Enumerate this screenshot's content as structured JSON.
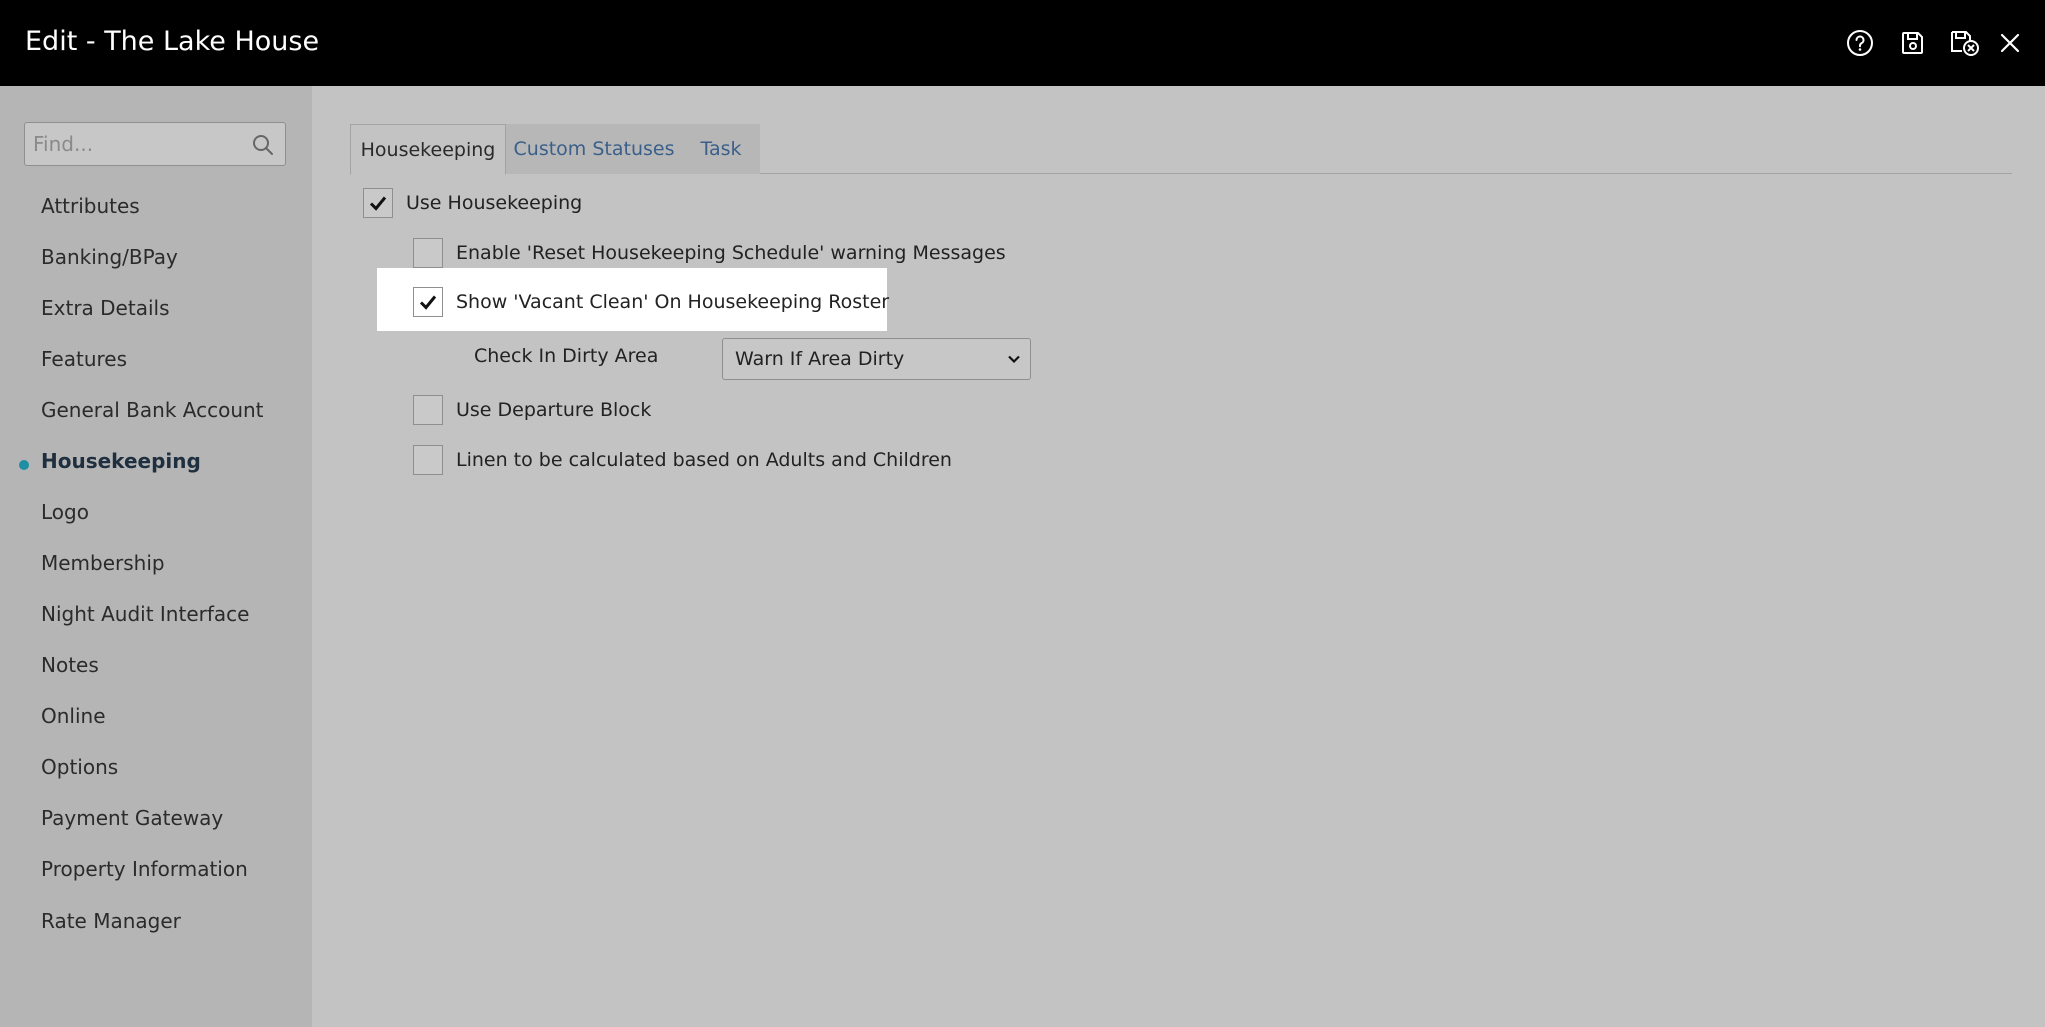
{
  "header": {
    "title": "Edit - The Lake House"
  },
  "sidebar": {
    "search_placeholder": "Find...",
    "items": [
      {
        "label": "Attributes"
      },
      {
        "label": "Banking/BPay"
      },
      {
        "label": "Extra Details"
      },
      {
        "label": "Features"
      },
      {
        "label": "General Bank Account"
      },
      {
        "label": "Housekeeping",
        "active": true
      },
      {
        "label": "Logo"
      },
      {
        "label": "Membership"
      },
      {
        "label": "Night Audit Interface"
      },
      {
        "label": "Notes"
      },
      {
        "label": "Online"
      },
      {
        "label": "Options"
      },
      {
        "label": "Payment Gateway"
      },
      {
        "label": "Property Information"
      },
      {
        "label": "Rate Manager"
      }
    ]
  },
  "tabs": [
    {
      "label": "Housekeeping",
      "active": true
    },
    {
      "label": "Custom Statuses",
      "active": false
    },
    {
      "label": "Task",
      "active": false
    }
  ],
  "settings": {
    "use_housekeeping": {
      "label": "Use Housekeeping",
      "checked": true
    },
    "reset_warning": {
      "label": "Enable 'Reset Housekeeping Schedule' warning Messages",
      "checked": false
    },
    "vacant_clean": {
      "label": "Show 'Vacant Clean' On Housekeeping Roster",
      "checked": true
    },
    "check_in_dirty": {
      "label": "Check In Dirty Area",
      "value": "Warn If Area Dirty"
    },
    "departure_block": {
      "label": "Use Departure Block",
      "checked": false
    },
    "linen_calc": {
      "label": "Linen to be calculated based on Adults and Children",
      "checked": false
    }
  },
  "colors": {
    "header_bg": "#000000",
    "active_dot": "#1d8ea3",
    "tab_link": "#3a5f8a",
    "highlight": "#ffffff"
  }
}
